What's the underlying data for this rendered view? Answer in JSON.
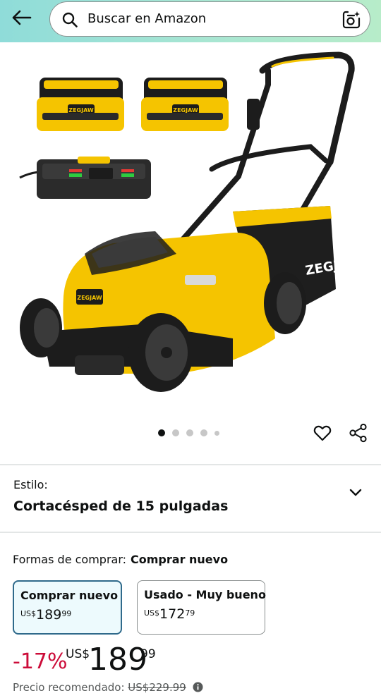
{
  "header": {
    "search_placeholder": "Buscar en Amazon",
    "back_icon": "arrow-left-icon",
    "camera_icon": "camera-lens-icon"
  },
  "gallery": {
    "image_description_icon": "product-image",
    "dot_count": 5,
    "active_dot": 0,
    "actions": [
      "heart-icon",
      "share-icon"
    ]
  },
  "style_selector": {
    "label": "Estilo:",
    "value": "Cortacésped de 15 pulgadas"
  },
  "buying_options": {
    "label": "Formas de comprar:",
    "selected_label": "Comprar nuevo",
    "options": [
      {
        "title": "Comprar nuevo",
        "currency": "US$",
        "whole": "189",
        "fraction": "99",
        "selected": true
      },
      {
        "title": "Usado - Muy bueno",
        "currency": "US$",
        "whole": "172",
        "fraction": "79",
        "selected": false
      }
    ]
  },
  "price": {
    "discount": "-17%",
    "currency": "US$",
    "whole": "189",
    "fraction": "99",
    "list_label": "Precio recomendado:",
    "list_price": "US$229.99"
  },
  "colors": {
    "header_gradient_start": "#8fdcd9",
    "header_gradient_end": "#b7ecc9",
    "discount_red": "#cc0c39",
    "selected_border": "#2f6a8b",
    "selected_bg": "#edfafd",
    "product_yellow": "#f5c400"
  }
}
